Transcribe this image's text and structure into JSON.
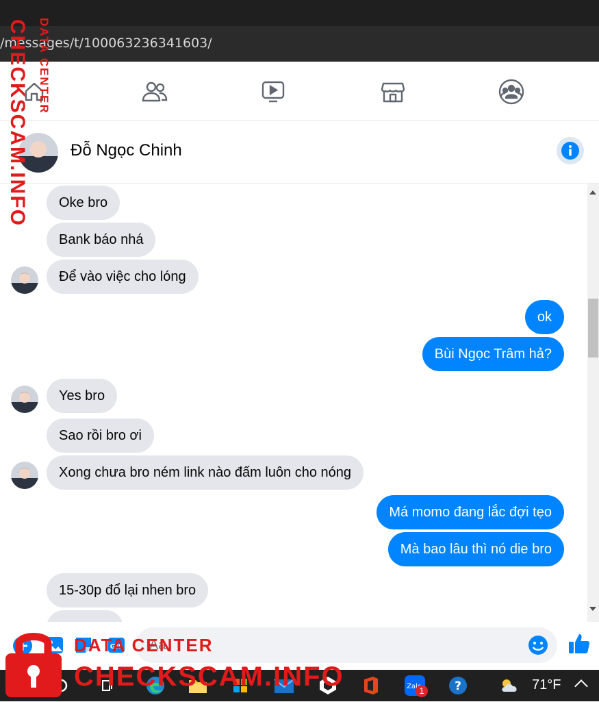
{
  "browser": {
    "url": "/messages/t/100063236341603/"
  },
  "nav": {
    "items": [
      {
        "name": "home-icon"
      },
      {
        "name": "friends-icon"
      },
      {
        "name": "watch-icon"
      },
      {
        "name": "marketplace-icon"
      },
      {
        "name": "groups-icon"
      }
    ]
  },
  "chat": {
    "contact_name": "Đỗ Ngọc Chinh"
  },
  "messages": [
    {
      "side": "in",
      "text": "Oke bro"
    },
    {
      "side": "in",
      "text": "Bank báo nhá"
    },
    {
      "side": "in",
      "text": "Để vào việc cho lóng"
    },
    {
      "side": "out",
      "text": "ok"
    },
    {
      "side": "out",
      "text": "Bùi Ngọc Trâm hả?"
    },
    {
      "side": "in",
      "text": "Yes bro"
    },
    {
      "side": "in",
      "text": "Sao rồi bro ơi"
    },
    {
      "side": "in",
      "text": "Xong chưa bro ném link nào đấm luôn cho nóng"
    },
    {
      "side": "out",
      "text": "Má momo đang lắc đợi tẹo"
    },
    {
      "side": "out",
      "text": "Mà bao lâu thì nó die bro"
    },
    {
      "side": "in",
      "text": "15-30p đổ lại nhen bro"
    }
  ],
  "composer": {
    "placeholder": "Aa"
  },
  "taskbar": {
    "weather": "71°F",
    "zalo_badge": "1"
  },
  "watermark": {
    "line1": "DATA CENTER",
    "line2": "CHECKSCAM.INFO"
  },
  "colors": {
    "accent": "#0084ff",
    "incoming_bubble": "#e4e6eb",
    "watermark": "#e11b1b"
  }
}
